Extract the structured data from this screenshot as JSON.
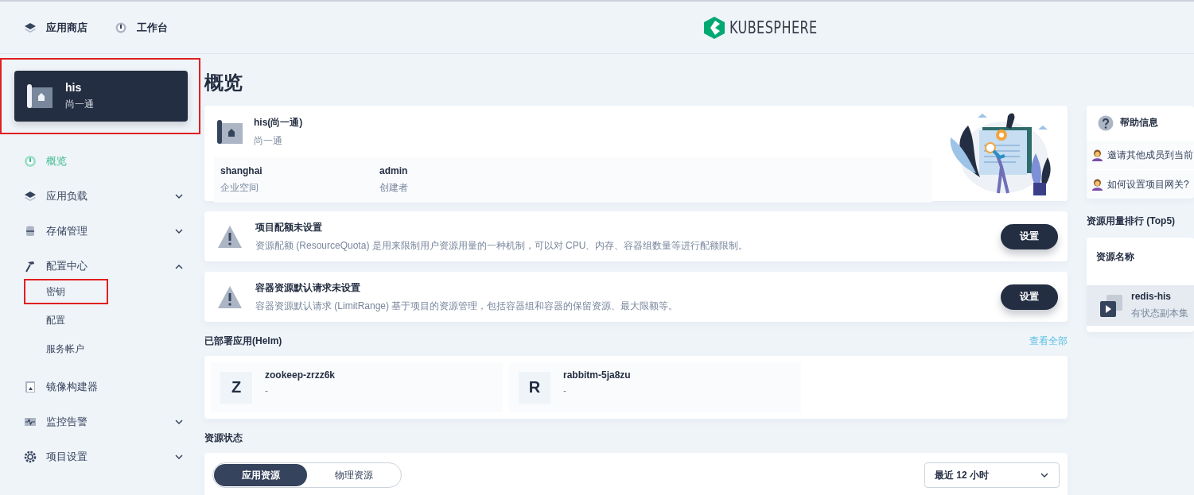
{
  "header": {
    "nav": [
      {
        "label": "应用商店"
      },
      {
        "label": "工作台"
      }
    ],
    "logo_text": "KUBESPHERE"
  },
  "project": {
    "name": "his",
    "alias": "尚一通",
    "highlighted": true
  },
  "sidebar": {
    "items": [
      {
        "kind": "link",
        "label": "概览",
        "selected": true
      },
      {
        "kind": "group",
        "label": "应用负载",
        "selected": false,
        "expanded": false
      },
      {
        "kind": "group",
        "label": "存储管理",
        "selected": false,
        "expanded": false
      },
      {
        "kind": "group",
        "label": "配置中心",
        "selected": false,
        "expanded": true,
        "children": [
          {
            "label": "密钥",
            "selected": false,
            "highlighted": true
          },
          {
            "label": "配置",
            "selected": false,
            "highlighted": false
          },
          {
            "label": "服务帐户",
            "selected": false,
            "highlighted": false
          }
        ]
      },
      {
        "kind": "link",
        "label": "镜像构建器",
        "selected": false
      },
      {
        "kind": "group",
        "label": "监控告警",
        "selected": false,
        "expanded": false
      },
      {
        "kind": "group",
        "label": "项目设置",
        "selected": false,
        "expanded": false
      }
    ]
  },
  "page_title": "概览",
  "info_card": {
    "title": "his(尚一通)",
    "subtitle": "尚一通",
    "fields": [
      {
        "value": "shanghai",
        "label": "企业空间"
      },
      {
        "value": "admin",
        "label": "创建者"
      }
    ]
  },
  "warnings": [
    {
      "title": "项目配额未设置",
      "description": "资源配额 (ResourceQuota) 是用来限制用户资源用量的一种机制，可以对 CPU、内存、容器组数量等进行配额限制。",
      "button": "设置"
    },
    {
      "title": "容器资源默认请求未设置",
      "description": "容器资源默认请求 (LimitRange) 基于项目的资源管理，包括容器组和容器的保留资源、最大限额等。",
      "button": "设置"
    }
  ],
  "deployed_apps": {
    "title": "已部署应用(Helm)",
    "link": "查看全部",
    "apps": [
      {
        "letter": "Z",
        "name": "zookeep-zrzz6k",
        "description": "-"
      },
      {
        "letter": "R",
        "name": "rabbitm-5ja8zu",
        "description": "-"
      }
    ]
  },
  "resource_status": {
    "title": "资源状态",
    "tabs": [
      {
        "label": "应用资源",
        "selected": true
      },
      {
        "label": "物理资源",
        "selected": false
      }
    ],
    "time_select": "最近 12 小时"
  },
  "help": {
    "title": "帮助信息",
    "items": [
      "邀请其他成员到当前",
      "如何设置项目网关?"
    ]
  },
  "ranking": {
    "title": "资源用量排行 (Top5)",
    "column": "资源名称",
    "rows": [
      {
        "name": "redis-his",
        "type": "有状态副本集"
      }
    ]
  }
}
